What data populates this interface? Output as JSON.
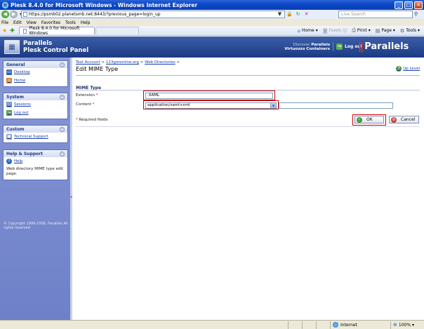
{
  "window": {
    "title": "Plesk 8.4.0 for Microsoft Windows - Windows Internet Explorer",
    "minimize": "_",
    "maximize": "□",
    "close": "✕"
  },
  "browser": {
    "url": "https://psmb02.planetsmb.net:8443/?previous_page=login_up",
    "search_placeholder": "Live Search",
    "menu": [
      "File",
      "Edit",
      "View",
      "Favorites",
      "Tools",
      "Help"
    ],
    "tab_title": "Plesk 8.4.0 for Microsoft Windows",
    "commands": {
      "home": "Home",
      "feeds": "Feeds (J)",
      "print": "Print",
      "page": "Page",
      "tools": "Tools"
    },
    "status": {
      "zone": "Internet",
      "zoom": "100%"
    }
  },
  "header": {
    "brand_line1": "Parallels",
    "brand_line2": "Plesk Control Panel",
    "discover_line1_prefix": "Discover ",
    "discover_line1_strong": "Parallels",
    "discover_line2": "Virtuozzo Containers",
    "logout": "Log out",
    "parallels_logo": "Parallels"
  },
  "sidebar": {
    "general": {
      "title": "General",
      "items": [
        "Desktop",
        "Home"
      ]
    },
    "system": {
      "title": "System",
      "items": [
        "Sessions",
        "Log out"
      ]
    },
    "custom": {
      "title": "Custom",
      "items": [
        "Technical Support"
      ]
    },
    "help": {
      "title": "Help & Support",
      "items": [
        "Help"
      ],
      "text": "Web directory MIME type edit page."
    },
    "copyright": "© Copyright 1999-2008, Parallels All rights reserved"
  },
  "main": {
    "breadcrumb": [
      "Test Account",
      "123gotonline.org",
      "Web Directories"
    ],
    "breadcrumb_sep": " > ",
    "title": "Edit MIME Type",
    "up_level": "Up Level",
    "section": "MIME Type",
    "extension_label": "Extension",
    "extension_value": ".XAML",
    "content_label": "Content",
    "content_value": "application/xaml+xml",
    "required_star": " *",
    "required_note": "Required fields",
    "required_note_star": "* ",
    "ok": "OK",
    "cancel": "Cancel"
  },
  "colors": {
    "accent": "#1c3a84",
    "highlight": "#cc0000",
    "sidebar": "#7a8bcf"
  }
}
